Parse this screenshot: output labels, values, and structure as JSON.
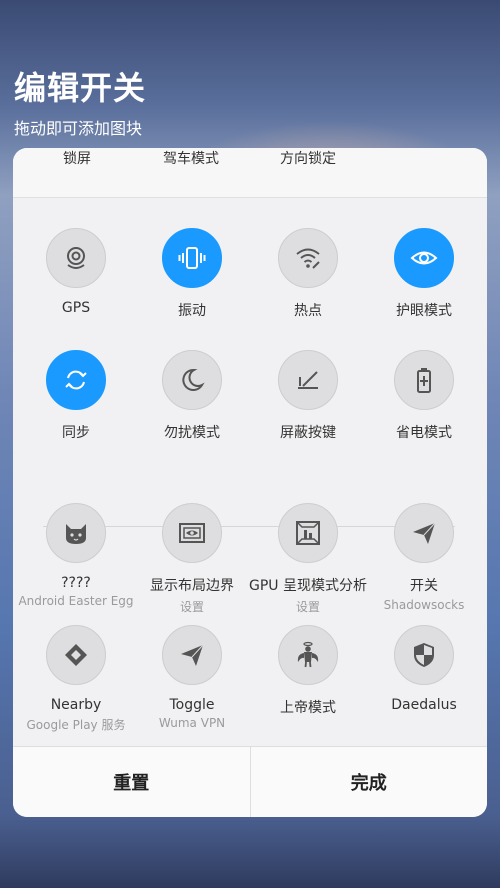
{
  "header": {
    "title": "编辑开关",
    "subtitle": "拖动即可添加图块"
  },
  "top_strip": {
    "items": [
      {
        "label": "锁屏"
      },
      {
        "label": "驾车模式"
      },
      {
        "label": "方向锁定"
      }
    ]
  },
  "active_tiles": [
    {
      "label": "GPS",
      "icon": "gps-icon",
      "active": false
    },
    {
      "label": "振动",
      "icon": "vibrate-icon",
      "active": true
    },
    {
      "label": "热点",
      "icon": "hotspot-icon",
      "active": false
    },
    {
      "label": "护眼模式",
      "icon": "eye-icon",
      "active": true
    },
    {
      "label": "同步",
      "icon": "sync-icon",
      "active": true
    },
    {
      "label": "勿扰模式",
      "icon": "moon-icon",
      "active": false
    },
    {
      "label": "屏蔽按键",
      "icon": "block-keys-icon",
      "active": false
    },
    {
      "label": "省电模式",
      "icon": "battery-icon",
      "active": false
    }
  ],
  "available_tiles": [
    {
      "label": "????",
      "sublabel": "Android Easter Egg",
      "icon": "cat-icon"
    },
    {
      "label": "显示布局边界",
      "sublabel": "设置",
      "icon": "layout-bounds-icon"
    },
    {
      "label": "GPU 呈现模式分析",
      "sublabel": "设置",
      "icon": "gpu-profile-icon"
    },
    {
      "label": "开关",
      "sublabel": "Shadowsocks",
      "icon": "paper-plane-icon"
    },
    {
      "label": "Nearby",
      "sublabel": "Google Play 服务",
      "icon": "nearby-icon"
    },
    {
      "label": "Toggle",
      "sublabel": "Wuma VPN",
      "icon": "paper-plane-icon"
    },
    {
      "label": "上帝模式",
      "sublabel": "",
      "icon": "god-mode-icon"
    },
    {
      "label": "Daedalus",
      "sublabel": "",
      "icon": "shield-icon"
    }
  ],
  "bottom": {
    "reset_label": "重置",
    "done_label": "完成"
  },
  "colors": {
    "accent": "#1a9aff",
    "tile_bg": "#dedee0",
    "icon_gray": "#555555"
  }
}
